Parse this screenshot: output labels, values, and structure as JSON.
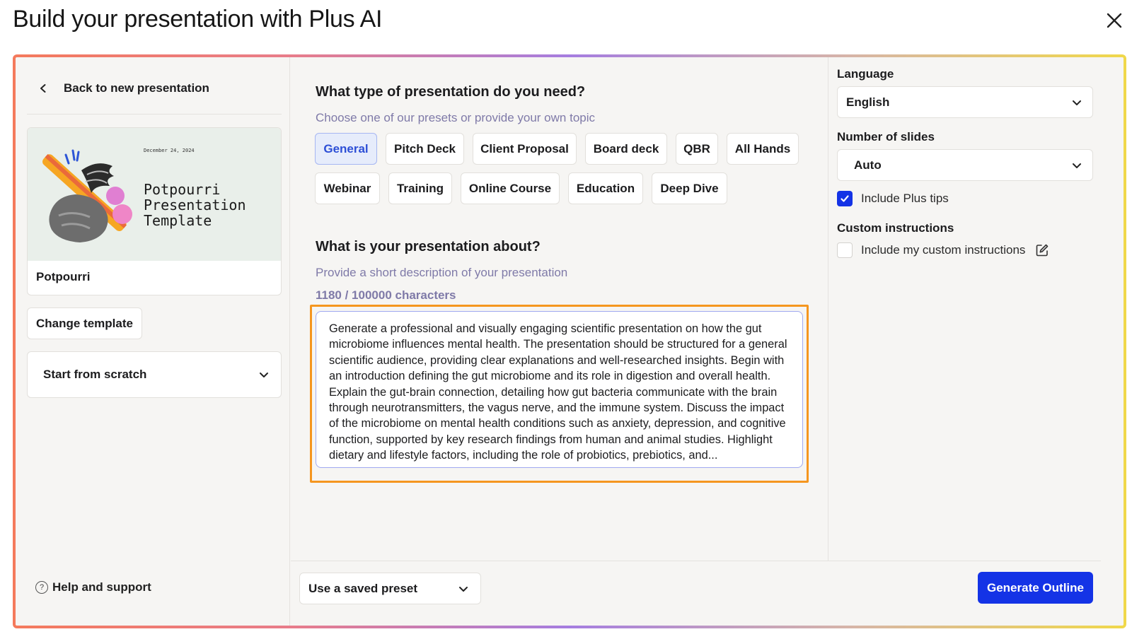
{
  "header": {
    "title": "Build your presentation with Plus AI"
  },
  "sidebar": {
    "back_label": "Back to new presentation",
    "template": {
      "thumb_date": "December 24, 2024",
      "thumb_title_lines": [
        "Potpourri",
        "Presentation",
        "Template"
      ],
      "name": "Potpourri"
    },
    "change_template_label": "Change template",
    "start_select": "Start from scratch",
    "help_label": "Help and support"
  },
  "main": {
    "type_question": "What type of presentation do you need?",
    "type_hint": "Choose one of our presets or provide your own topic",
    "presets": [
      "General",
      "Pitch Deck",
      "Client Proposal",
      "Board deck",
      "QBR",
      "All Hands",
      "Webinar",
      "Training",
      "Online Course",
      "Education",
      "Deep Dive"
    ],
    "selected_preset": "General",
    "about_question": "What is your presentation about?",
    "about_hint": "Provide a short description of your presentation",
    "char_count": "1180 / 100000 characters",
    "description": "Generate a professional and visually engaging scientific presentation on how the gut microbiome influences mental health. The presentation should be structured for a general scientific audience, providing clear explanations and well-researched insights. Begin with an introduction defining the gut microbiome and its role in digestion and overall health. Explain the gut-brain connection, detailing how gut bacteria communicate with the brain through neurotransmitters, the vagus nerve, and the immune system. Discuss the impact of the microbiome on mental health conditions such as anxiety, depression, and cognitive function, supported by key research findings from human and animal studies. Highlight dietary and lifestyle factors, including the role of probiotics, prebiotics, and..."
  },
  "footer": {
    "saved_preset_label": "Use a saved preset",
    "generate_label": "Generate Outline"
  },
  "settings": {
    "language_label": "Language",
    "language_value": "English",
    "slides_label": "Number of slides",
    "slides_value": "Auto",
    "plus_tips_label": "Include Plus tips",
    "plus_tips_checked": true,
    "custom_label": "Custom instructions",
    "custom_check_label": "Include my custom instructions",
    "custom_checked": false
  },
  "colors": {
    "accent": "#1433e6",
    "highlight": "#f5961f",
    "hint_text": "#7f7aa8",
    "active_chip_bg": "#e6ecfb"
  },
  "icons": [
    "close-icon",
    "chevron-left-icon",
    "chevron-down-icon",
    "help-icon",
    "edit-icon",
    "checkmark-icon"
  ]
}
